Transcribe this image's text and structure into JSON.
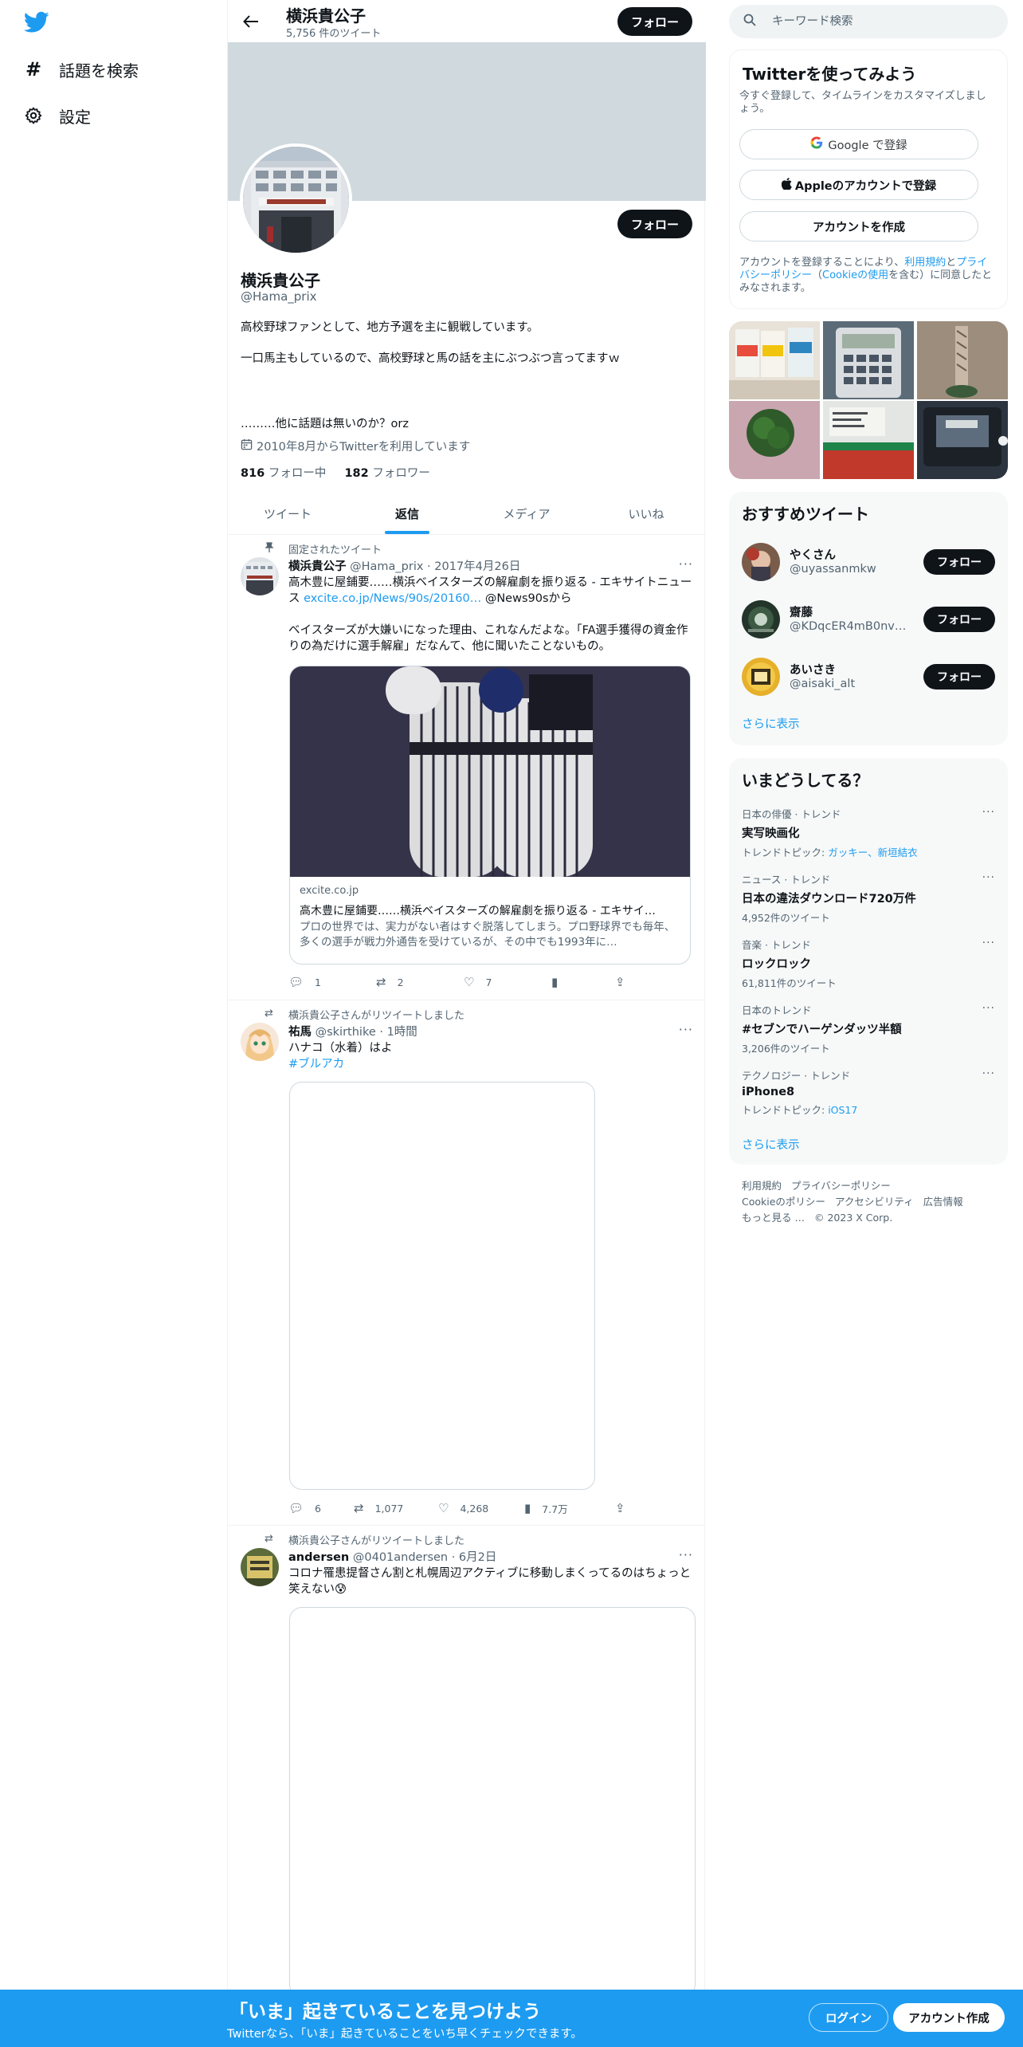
{
  "nav": {
    "logo_icon": "twitter-bird-icon",
    "explore_label": "話題を検索",
    "settings_label": "設定"
  },
  "header": {
    "title": "横浜貴公子",
    "tweet_count": "5,756 件のツイート",
    "follow_label": "フォロー"
  },
  "profile": {
    "name": "横浜貴公子",
    "handle": "@Hama_prix",
    "follow_label": "フォロー",
    "bio_line1": "高校野球ファンとして、地方予選を主に観戦しています。",
    "bio_line2": "一口馬主もしているので、高校野球と馬の話を主にぶつぶつ言ってますｗ",
    "bio_line3": "………他に話題は無いのか？orz",
    "joined": "2010年8月からTwitterを利用しています",
    "following_count": "816",
    "following_label": "フォロー中",
    "followers_count": "182",
    "followers_label": "フォロワー"
  },
  "tabs": [
    "ツイート",
    "返信",
    "メディア",
    "いいね"
  ],
  "active_tab": "返信",
  "tweets": [
    {
      "social": "固定されたツイート",
      "name": "横浜貴公子",
      "meta": "@Hama_prix · 2017年4月26日",
      "text_a": "高木豊に屋鋪要……横浜ベイスターズの解雇劇を振り返る - エキサイトニュース ",
      "link": "excite.co.jp/News/90s/20160…",
      "text_b": " @News90sから",
      "text_c": "ベイスターズが大嫌いになった理由、これなんだよな。「FA選手獲得の資金作りの為だけに選手解雇」だなんて、他に聞いたことないもの。",
      "card_domain": "excite.co.jp",
      "card_title": "高木豊に屋鋪要……横浜ベイスターズの解雇劇を振り返る - エキサイ…",
      "card_desc": "プロの世界では、実力がない者はすぐ脱落してしまう。プロ野球界でも毎年、多くの選手が戦力外通告を受けているが、その中でも1993年に…",
      "replies": "1",
      "retweets": "2",
      "likes": "7",
      "views": ""
    },
    {
      "social": "横浜貴公子さんがリツイートしました",
      "name": "祐馬",
      "meta": "@skirthike · 1時間",
      "text_a": "ハナコ（水着）はよ",
      "hashtag": "#ブルアカ",
      "replies": "6",
      "retweets": "1,077",
      "likes": "4,268",
      "views": "7.7万"
    },
    {
      "social": "横浜貴公子さんがリツイートしました",
      "name": "andersen",
      "meta": "@0401andersen · 6月2日",
      "text_a": "コロナ罹患提督さん割と札幌周辺アクティブに移動しまくってるのはちょっと笑えない😰"
    }
  ],
  "right": {
    "search_placeholder": "キーワード検索",
    "signup_card": {
      "title": "Twitterを使ってみよう",
      "sub": "今すぐ登録して、タイムラインをカスタマイズしましょう。",
      "google": "Google で登録",
      "apple": "Appleのアカウントで登録",
      "create": "アカウントを作成",
      "terms_a": "アカウントを登録することにより、",
      "terms_link1": "利用規約",
      "terms_b": "と",
      "terms_link2": "プライバシーポリシー",
      "terms_c": "（",
      "terms_link3": "Cookieの使用",
      "terms_d": "を含む）に同意したとみなされます。"
    },
    "suggest": {
      "title": "おすすめツイート",
      "users": [
        {
          "name": "やくさん",
          "handle": "@uyassanmkw",
          "follow": "フォロー"
        },
        {
          "name": "齋藤",
          "handle": "@KDqcER4mB0nvQ...",
          "follow": "フォロー"
        },
        {
          "name": "あいさき",
          "handle": "@aisaki_alt",
          "follow": "フォロー"
        }
      ],
      "more": "さらに表示"
    },
    "trends": {
      "title": "いまどうしてる？",
      "items": [
        {
          "cat": "日本の俳優 · トレンド",
          "title": "実写映画化",
          "extra_a": "トレンドトピック: ",
          "extra_link": "ガッキー、新垣結衣"
        },
        {
          "cat": "ニュース · トレンド",
          "title": "日本の違法ダウンロード720万件",
          "extra_a": "4,952件のツイート",
          "extra_link": ""
        },
        {
          "cat": "音楽 · トレンド",
          "title": "ロックロック",
          "extra_a": "61,811件のツイート",
          "extra_link": ""
        },
        {
          "cat": "日本のトレンド",
          "title": "#セブンでハーゲンダッツ半額",
          "extra_a": "3,206件のツイート",
          "extra_link": ""
        },
        {
          "cat": "テクノロジー · トレンド",
          "title": "iPhone8",
          "extra_a": "トレンドトピック: ",
          "extra_link": "iOS17"
        }
      ],
      "more": "さらに表示"
    },
    "footer": {
      "terms": "利用規約",
      "privacy": "プライバシーポリシー",
      "cookie": "Cookieのポリシー",
      "access": "アクセシビリティ",
      "ads": "広告情報",
      "more": "もっと見る …",
      "copy": "© 2023 X Corp."
    }
  },
  "bottom": {
    "title": "「いま」起きていることを見つけよう",
    "sub": "Twitterなら、「いま」起きていることをいち早くチェックできます。",
    "login": "ログイン",
    "signup": "アカウント作成"
  },
  "colors": {
    "accent": "#1d9bf0",
    "text": "#0f1419",
    "secondary": "#536471",
    "banner": "#cfd9de"
  }
}
